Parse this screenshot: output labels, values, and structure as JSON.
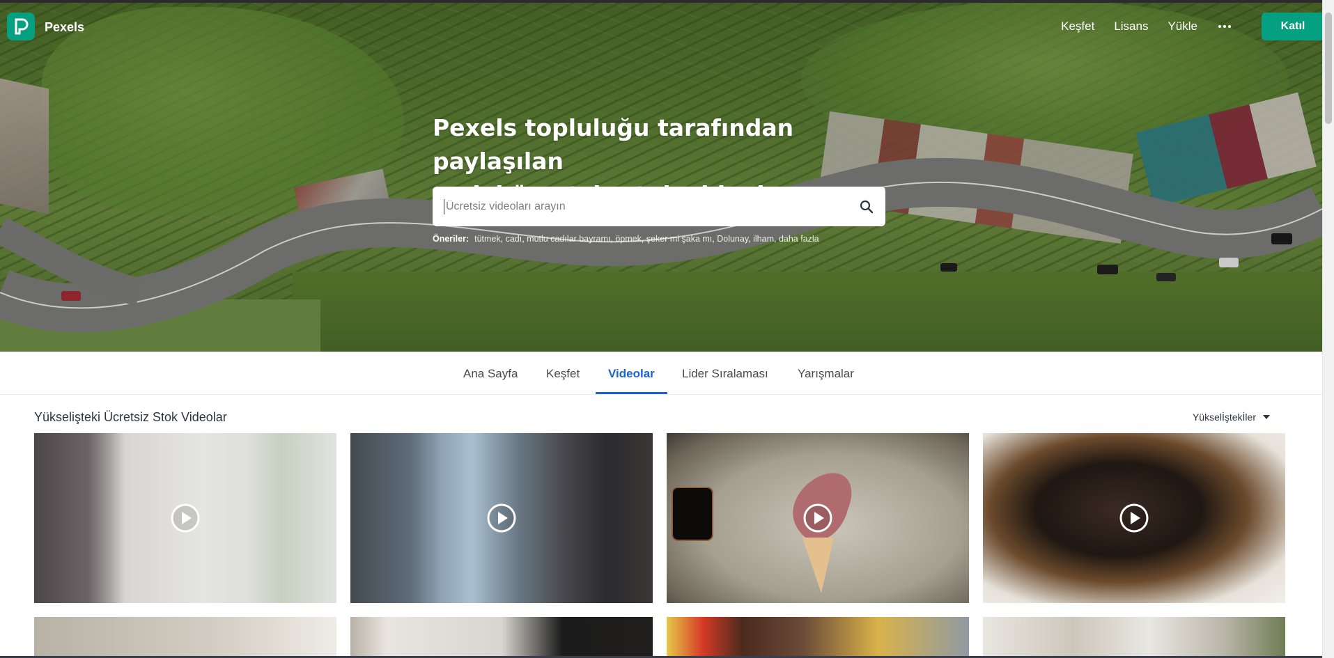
{
  "brand": {
    "name": "Pexels",
    "accent": "#05a081"
  },
  "nav": {
    "links": [
      "Keşfet",
      "Lisans",
      "Yükle"
    ],
    "more_icon": "ellipsis-icon",
    "join_label": "Katıl"
  },
  "hero": {
    "title_line1": "Pexels topluluğu tarafından paylaşılan",
    "title_line2": "en iyi ücretsiz stok videolar.",
    "search_placeholder": "Ücretsiz videoları arayın",
    "search_value": "",
    "suggestions_label": "Öneriler:",
    "suggestions": [
      "tütmek",
      "cadı",
      "mutlu cadılar bayramı",
      "öpmek",
      "şeker mi şaka mı",
      "Dolunay",
      "ilham"
    ],
    "more_suggestions": "daha fazla"
  },
  "tabs": {
    "items": [
      "Ana Sayfa",
      "Keşfet",
      "Videolar",
      "Lider Sıralaması",
      "Yarışmalar"
    ],
    "active_index": 2,
    "active_color": "#1a62d4"
  },
  "section": {
    "title": "Yükselişteki Ücretsiz Stok Videolar",
    "sort_label": "Yükselİştekİler"
  },
  "videos": {
    "row1_play_icon": "play-icon",
    "tiles": [
      "video-1",
      "video-2",
      "video-3",
      "video-4",
      "video-5",
      "video-6",
      "video-7",
      "video-8"
    ]
  }
}
